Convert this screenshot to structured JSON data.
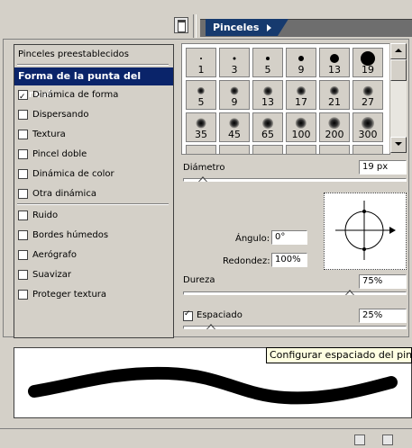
{
  "panel": {
    "tab_label": "Pinceles",
    "dock_icon": "palette-dock-icon",
    "menu_arrow_icon": "triangle-right-icon"
  },
  "sidebar": {
    "items": [
      {
        "label": "Pinceles preestablecidos",
        "type": "header"
      },
      {
        "label": "Forma de la punta del pincel",
        "type": "selected"
      },
      {
        "label": "Dinámica de forma",
        "type": "checkbox",
        "checked": true
      },
      {
        "label": "Dispersando",
        "type": "checkbox",
        "checked": false
      },
      {
        "label": "Textura",
        "type": "checkbox",
        "checked": false
      },
      {
        "label": "Pincel doble",
        "type": "checkbox",
        "checked": false
      },
      {
        "label": "Dinámica de color",
        "type": "checkbox",
        "checked": false
      },
      {
        "label": "Otra dinámica",
        "type": "checkbox",
        "checked": false
      },
      {
        "label": "Ruido",
        "type": "checkbox",
        "checked": false
      },
      {
        "label": "Bordes húmedos",
        "type": "checkbox",
        "checked": false
      },
      {
        "label": "Aerógrafo",
        "type": "checkbox",
        "checked": false
      },
      {
        "label": "Suavizar",
        "type": "checkbox",
        "checked": false
      },
      {
        "label": "Proteger textura",
        "type": "checkbox",
        "checked": false
      }
    ]
  },
  "brushes": [
    {
      "size": "1",
      "style": "hard"
    },
    {
      "size": "3",
      "style": "hard"
    },
    {
      "size": "5",
      "style": "hard"
    },
    {
      "size": "9",
      "style": "hard"
    },
    {
      "size": "13",
      "style": "hard"
    },
    {
      "size": "19",
      "style": "hard",
      "selected": true
    },
    {
      "size": "5",
      "style": "soft"
    },
    {
      "size": "9",
      "style": "soft"
    },
    {
      "size": "13",
      "style": "soft"
    },
    {
      "size": "17",
      "style": "soft"
    },
    {
      "size": "21",
      "style": "soft"
    },
    {
      "size": "27",
      "style": "soft"
    },
    {
      "size": "35",
      "style": "soft"
    },
    {
      "size": "45",
      "style": "soft"
    },
    {
      "size": "65",
      "style": "soft"
    },
    {
      "size": "100",
      "style": "soft"
    },
    {
      "size": "200",
      "style": "soft"
    },
    {
      "size": "300",
      "style": "soft"
    },
    {
      "size": "",
      "style": "texture"
    },
    {
      "size": "",
      "style": "texture"
    },
    {
      "size": "",
      "style": "texture"
    },
    {
      "size": "",
      "style": "texture"
    },
    {
      "size": "",
      "style": "texture"
    },
    {
      "size": "",
      "style": "texture"
    }
  ],
  "controls": {
    "diameter_label": "Diámetro",
    "diameter_value": "19 px",
    "diameter_fraction": 0.08,
    "angle_label": "Ángulo:",
    "angle_value": "0°",
    "roundness_label": "Redondez:",
    "roundness_value": "100%",
    "hardness_label": "Dureza",
    "hardness_value": "75%",
    "hardness_fraction": 0.75,
    "spacing_label": "Espaciado",
    "spacing_checked": true,
    "spacing_value": "25%",
    "spacing_fraction": 0.12
  },
  "tooltip": {
    "text": "Configurar espaciado del pincel"
  },
  "colors": {
    "selection": "#0a246a",
    "tab": "#163a6e",
    "face": "#d4d0c8"
  }
}
